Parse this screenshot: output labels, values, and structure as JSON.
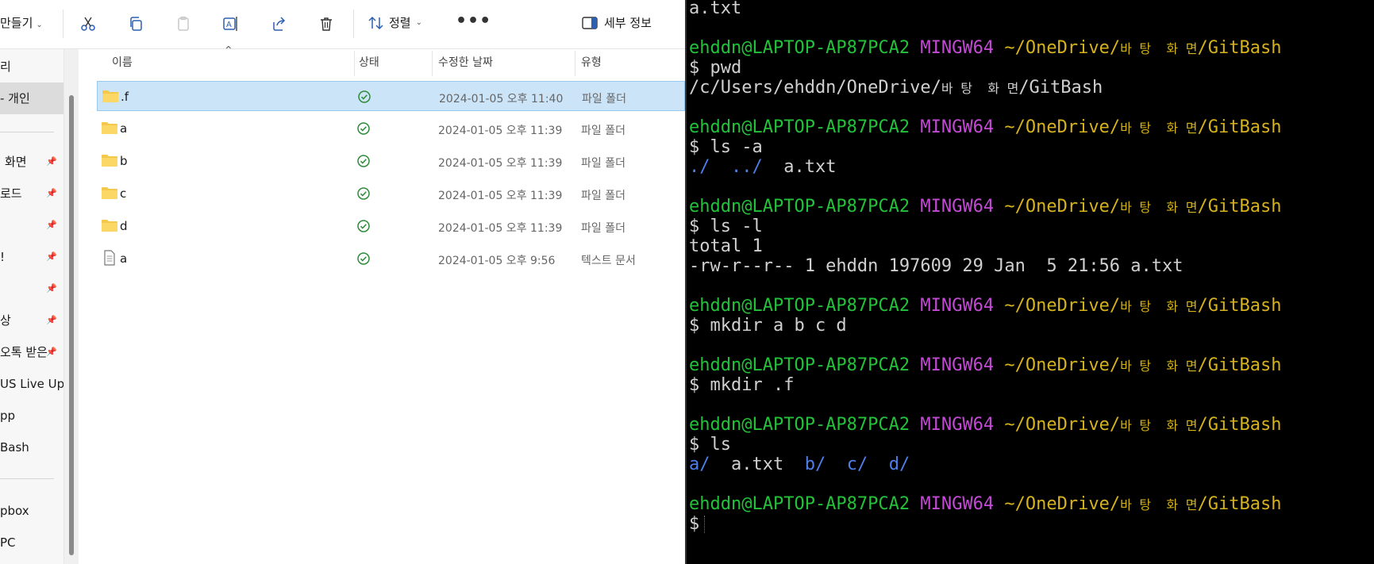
{
  "toolbar": {
    "new_label": "만들기",
    "sort_label": "정렬",
    "more_label": "•••",
    "details_label": "세부 정보"
  },
  "nav": {
    "items": [
      {
        "label": "리",
        "pinned": false
      },
      {
        "label": "- 개인",
        "pinned": false,
        "selected": true
      },
      {
        "label": "화면",
        "pinned": true
      },
      {
        "label": "로드",
        "pinned": true
      },
      {
        "label": "",
        "pinned": true
      },
      {
        "label": "!",
        "pinned": true
      },
      {
        "label": "",
        "pinned": true
      },
      {
        "label": "상",
        "pinned": true
      },
      {
        "label": "오톡 받은",
        "pinned": true
      },
      {
        "label": "US Live Upda",
        "pinned": false
      },
      {
        "label": "pp",
        "pinned": false
      },
      {
        "label": "Bash",
        "pinned": false
      },
      {
        "label": "pbox",
        "pinned": false
      },
      {
        "label": "PC",
        "pinned": false
      }
    ]
  },
  "list": {
    "columns": [
      "이름",
      "상태",
      "수정한 날짜",
      "유형"
    ],
    "rows": [
      {
        "name": ".f",
        "icon": "folder",
        "date": "2024-01-05 오후 11:40",
        "type": "파일 폴더",
        "selected": true
      },
      {
        "name": "a",
        "icon": "folder",
        "date": "2024-01-05 오후 11:39",
        "type": "파일 폴더"
      },
      {
        "name": "b",
        "icon": "folder",
        "date": "2024-01-05 오후 11:39",
        "type": "파일 폴더"
      },
      {
        "name": "c",
        "icon": "folder",
        "date": "2024-01-05 오후 11:39",
        "type": "파일 폴더"
      },
      {
        "name": "d",
        "icon": "folder",
        "date": "2024-01-05 오후 11:39",
        "type": "파일 폴더"
      },
      {
        "name": "a",
        "icon": "text-file",
        "date": "2024-01-05 오후 9:56",
        "type": "텍스트 문서"
      }
    ]
  },
  "terminal": {
    "prompt": {
      "user": "ehddn@LAPTOP-AP87PCA2",
      "env": "MINGW64",
      "path_start": "~/OneDrive/",
      "path_korean": "바 탕  화 면",
      "path_end": "/GitBash"
    },
    "top_output": "a.txt",
    "pwd_cmd": "$ pwd",
    "pwd_out_start": "/c/Users/ehddn/OneDrive/",
    "pwd_out_korean": "바 탕  화 면",
    "pwd_out_end": "/GitBash",
    "lsa_cmd": "$ ls -a",
    "lsa_dot": "./",
    "lsa_dotdot": "../",
    "lsa_file": "a.txt",
    "lsl_cmd": "$ ls -l",
    "lsl_total": "total 1",
    "lsl_line": "-rw-r--r-- 1 ehddn 197609 29 Jan  5 21:56 a.txt",
    "mkdir_cmd": "$ mkdir a b c d",
    "mkdirf_cmd": "$ mkdir .f",
    "ls_cmd": "$ ls",
    "ls_a": "a/",
    "ls_file": "a.txt",
    "ls_b": "b/",
    "ls_c": "c/",
    "ls_d": "d/",
    "final_prompt": "$"
  }
}
